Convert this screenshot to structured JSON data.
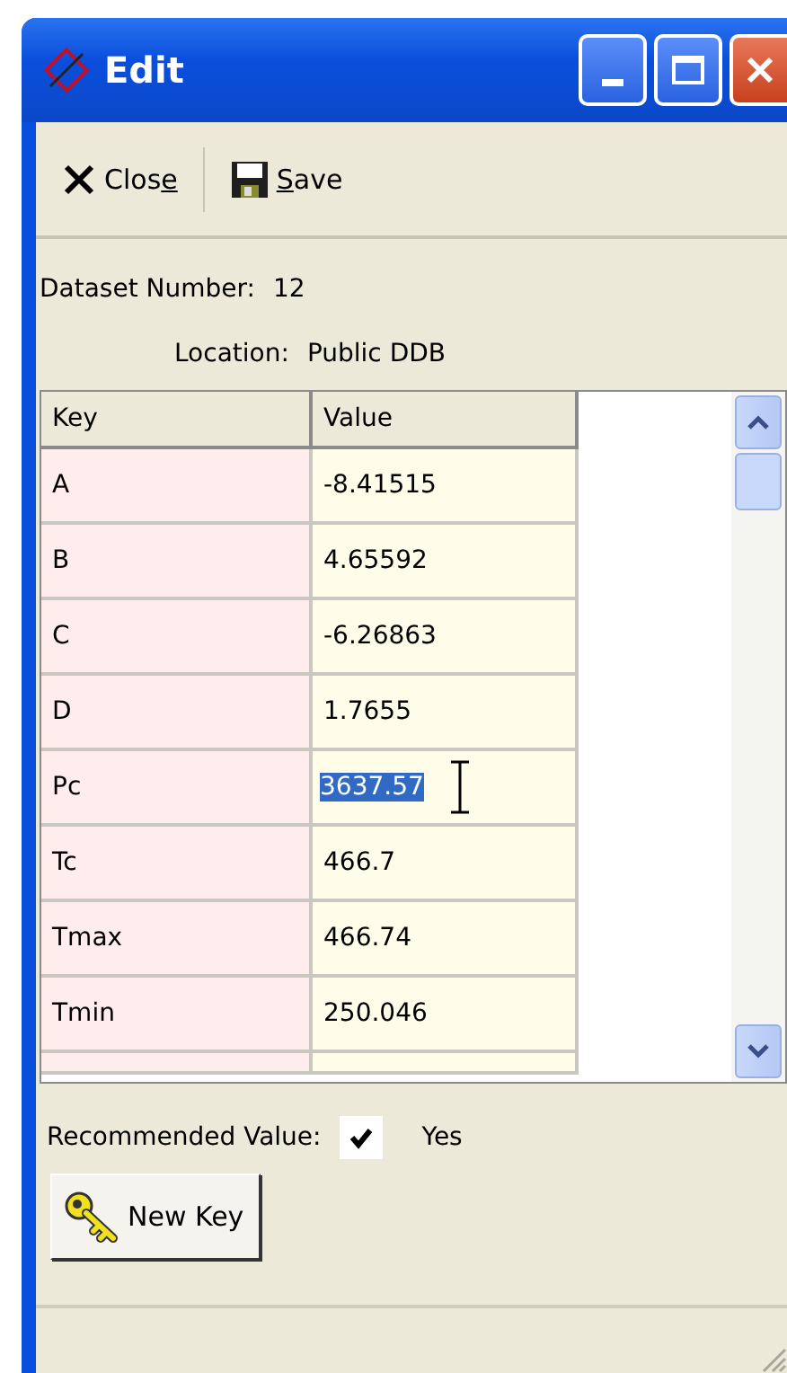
{
  "window": {
    "title": "Edit"
  },
  "toolbar": [
    {
      "label_start": "Clos",
      "mnemonic": "e",
      "kind": "close"
    },
    {
      "mnemonic": "S",
      "label_end": "ave",
      "kind": "save"
    }
  ],
  "info": [
    {
      "label": "Dataset Number:",
      "value": "12"
    },
    {
      "label": "Location:",
      "value": "Public DDB"
    }
  ],
  "table": {
    "columns": [
      "Key",
      "Value"
    ],
    "rows": [
      {
        "key": "A",
        "value": "-8.41515",
        "editing": false
      },
      {
        "key": "B",
        "value": "4.65592",
        "editing": false
      },
      {
        "key": "C",
        "value": "-6.26863",
        "editing": false
      },
      {
        "key": "D",
        "value": "1.7655",
        "editing": false
      },
      {
        "key": "Pc",
        "value": "3637.57",
        "editing": true
      },
      {
        "key": "Tc",
        "value": "466.7",
        "editing": false
      },
      {
        "key": "Tmax",
        "value": "466.74",
        "editing": false
      },
      {
        "key": "Tmin",
        "value": "250.046",
        "editing": false
      }
    ]
  },
  "recommended": {
    "label": "Recommended Value:",
    "checked": true,
    "text": "Yes"
  },
  "new_key_button": {
    "label": "New Key"
  }
}
